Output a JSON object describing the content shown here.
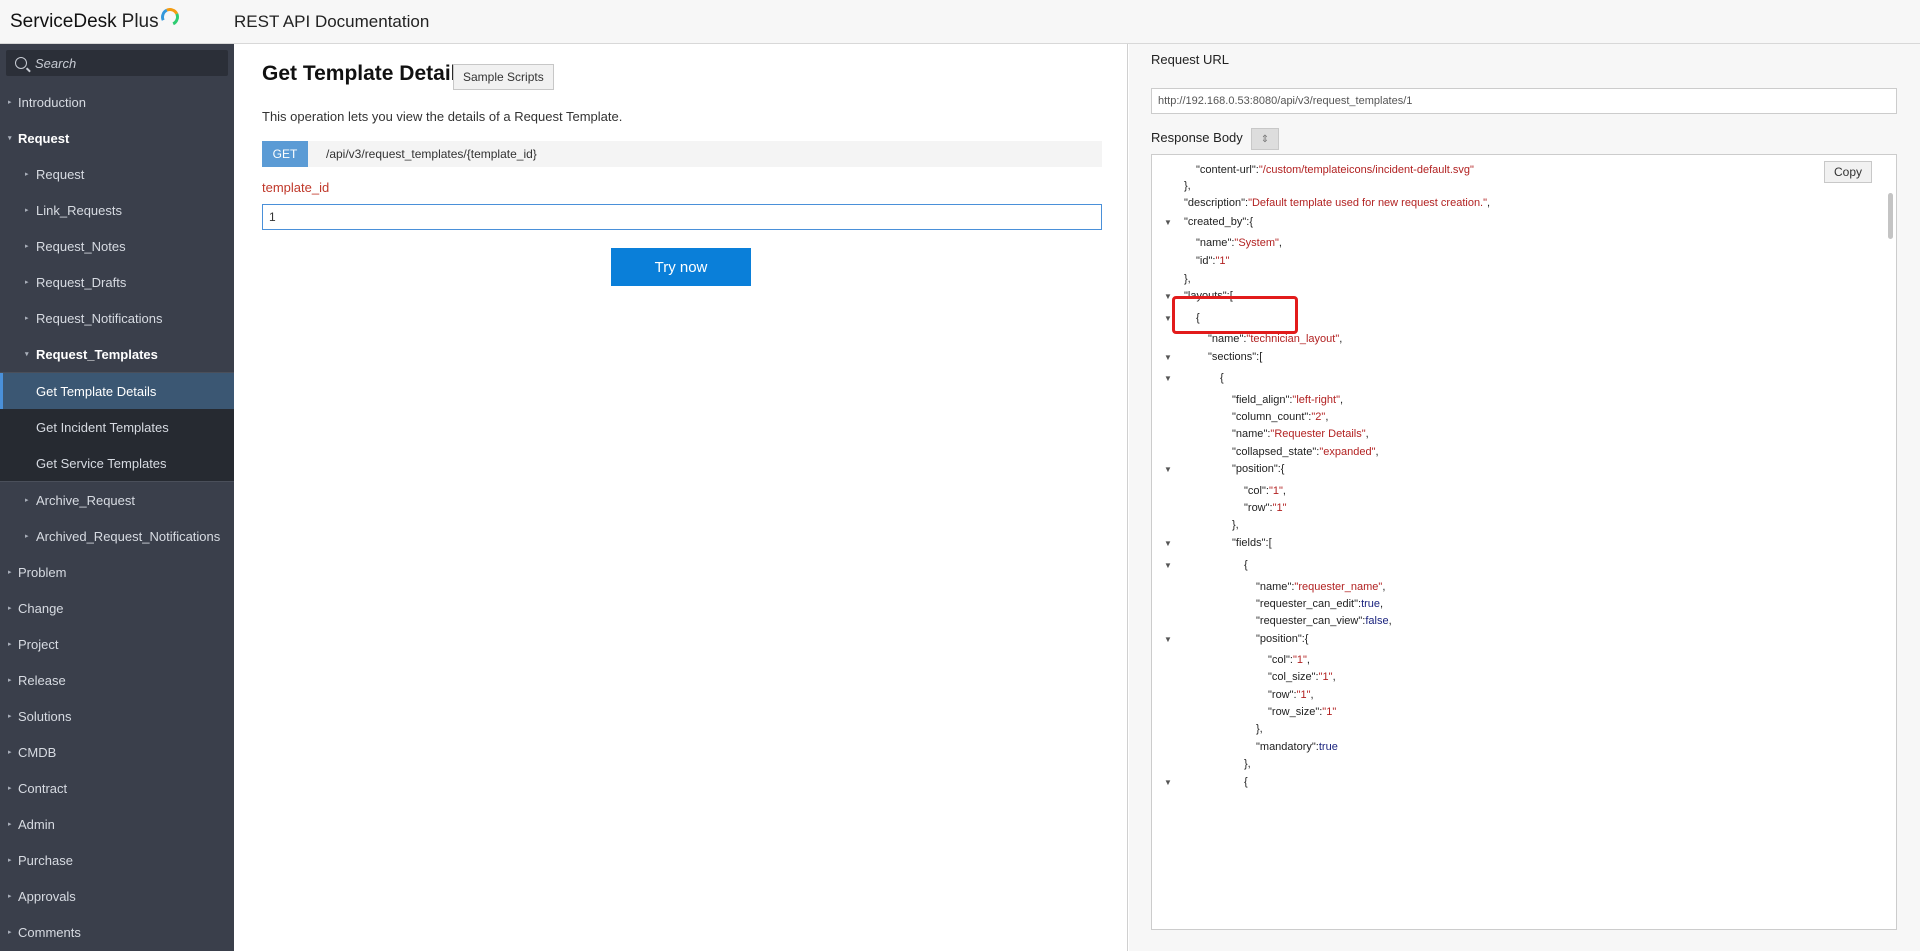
{
  "app": {
    "name": "ServiceDesk",
    "name_suffix": "Plus",
    "page_title": "REST API Documentation"
  },
  "sidebar": {
    "search_placeholder": "Search",
    "items": [
      {
        "label": "Introduction",
        "level": "top",
        "bold": false
      },
      {
        "label": "Request",
        "level": "top",
        "bold": true
      },
      {
        "label": "Request",
        "level": "sub"
      },
      {
        "label": "Link_Requests",
        "level": "sub"
      },
      {
        "label": "Request_Notes",
        "level": "sub"
      },
      {
        "label": "Request_Drafts",
        "level": "sub"
      },
      {
        "label": "Request_Notifications",
        "level": "sub"
      },
      {
        "label": "Request_Templates",
        "level": "sub",
        "bold": true
      }
    ],
    "template_children": [
      "Get Template Details",
      "Get Incident Templates",
      "Get Service Templates"
    ],
    "items_after": [
      {
        "label": "Archive_Request",
        "level": "sub"
      },
      {
        "label": "Archived_Request_Notifications",
        "level": "sub"
      },
      {
        "label": "Problem",
        "level": "top"
      },
      {
        "label": "Change",
        "level": "top"
      },
      {
        "label": "Project",
        "level": "top"
      },
      {
        "label": "Release",
        "level": "top"
      },
      {
        "label": "Solutions",
        "level": "top"
      },
      {
        "label": "CMDB",
        "level": "top"
      },
      {
        "label": "Contract",
        "level": "top"
      },
      {
        "label": "Admin",
        "level": "top"
      },
      {
        "label": "Purchase",
        "level": "top"
      },
      {
        "label": "Approvals",
        "level": "top"
      },
      {
        "label": "Comments",
        "level": "top"
      }
    ]
  },
  "main": {
    "title": "Get Template Details",
    "sample_scripts_label": "Sample Scripts",
    "description": "This operation lets you view the details of a Request Template.",
    "method": "GET",
    "path": "/api/v3/request_templates/{template_id}",
    "param_label": "template_id",
    "param_value": "1",
    "try_label": "Try now"
  },
  "right": {
    "request_url_label": "Request URL",
    "request_url": "http://192.168.0.53:8080/api/v3/request_templates/1",
    "response_body_label": "Response Body",
    "copy_label": "Copy",
    "json_lines": [
      {
        "indent": 1,
        "key": "content-url",
        "value": "/custom/templateicons/incident-default.svg",
        "type": "string",
        "comma": false,
        "collapse": false
      },
      {
        "indent": 0,
        "raw": "},"
      },
      {
        "indent": 0,
        "key": "description",
        "value": "Default template used for new request creation.",
        "type": "string",
        "comma": true
      },
      {
        "indent": 0,
        "key": "created_by",
        "open": "{",
        "collapse": true
      },
      {
        "indent": 1,
        "key": "name",
        "value": "System",
        "type": "string",
        "comma": true
      },
      {
        "indent": 1,
        "key": "id",
        "value": "1",
        "type": "string",
        "comma": false
      },
      {
        "indent": 0,
        "raw": "},"
      },
      {
        "indent": 0,
        "key": "layouts",
        "open": "[",
        "collapse": true
      },
      {
        "indent": 1,
        "raw": "{",
        "collapse": true
      },
      {
        "indent": 2,
        "key": "name",
        "value": "technician_layout",
        "type": "string",
        "comma": true
      },
      {
        "indent": 2,
        "key": "sections",
        "open": "[",
        "collapse": true
      },
      {
        "indent": 3,
        "raw": "{",
        "collapse": true
      },
      {
        "indent": 4,
        "key": "field_align",
        "value": "left-right",
        "type": "string",
        "comma": true
      },
      {
        "indent": 4,
        "key": "column_count",
        "value": "2",
        "type": "string",
        "comma": true
      },
      {
        "indent": 4,
        "key": "name",
        "value": "Requester Details",
        "type": "string",
        "comma": true
      },
      {
        "indent": 4,
        "key": "collapsed_state",
        "value": "expanded",
        "type": "string",
        "comma": true
      },
      {
        "indent": 4,
        "key": "position",
        "open": "{",
        "collapse": true
      },
      {
        "indent": 5,
        "key": "col",
        "value": "1",
        "type": "string",
        "comma": true
      },
      {
        "indent": 5,
        "key": "row",
        "value": "1",
        "type": "string",
        "comma": false
      },
      {
        "indent": 4,
        "raw": "},"
      },
      {
        "indent": 4,
        "key": "fields",
        "open": "[",
        "collapse": true
      },
      {
        "indent": 5,
        "raw": "{",
        "collapse": true
      },
      {
        "indent": 6,
        "key": "name",
        "value": "requester_name",
        "type": "string",
        "comma": true
      },
      {
        "indent": 6,
        "key": "requester_can_edit",
        "value": "true",
        "type": "bool",
        "comma": true
      },
      {
        "indent": 6,
        "key": "requester_can_view",
        "value": "false",
        "type": "bool",
        "comma": true
      },
      {
        "indent": 6,
        "key": "position",
        "open": "{",
        "collapse": true
      },
      {
        "indent": 7,
        "key": "col",
        "value": "1",
        "type": "string",
        "comma": true
      },
      {
        "indent": 7,
        "key": "col_size",
        "value": "1",
        "type": "string",
        "comma": true
      },
      {
        "indent": 7,
        "key": "row",
        "value": "1",
        "type": "string",
        "comma": true
      },
      {
        "indent": 7,
        "key": "row_size",
        "value": "1",
        "type": "string",
        "comma": false
      },
      {
        "indent": 6,
        "raw": "},"
      },
      {
        "indent": 6,
        "key": "mandatory",
        "value": "true",
        "type": "bool",
        "comma": false
      },
      {
        "indent": 5,
        "raw": "},"
      },
      {
        "indent": 5,
        "raw": "{",
        "collapse": true
      }
    ]
  },
  "colors": {
    "accent": "#0a7fd9",
    "sidebar_bg": "#3a3f4b",
    "active_item": "#3b5773",
    "highlight": "#e21b1b"
  }
}
